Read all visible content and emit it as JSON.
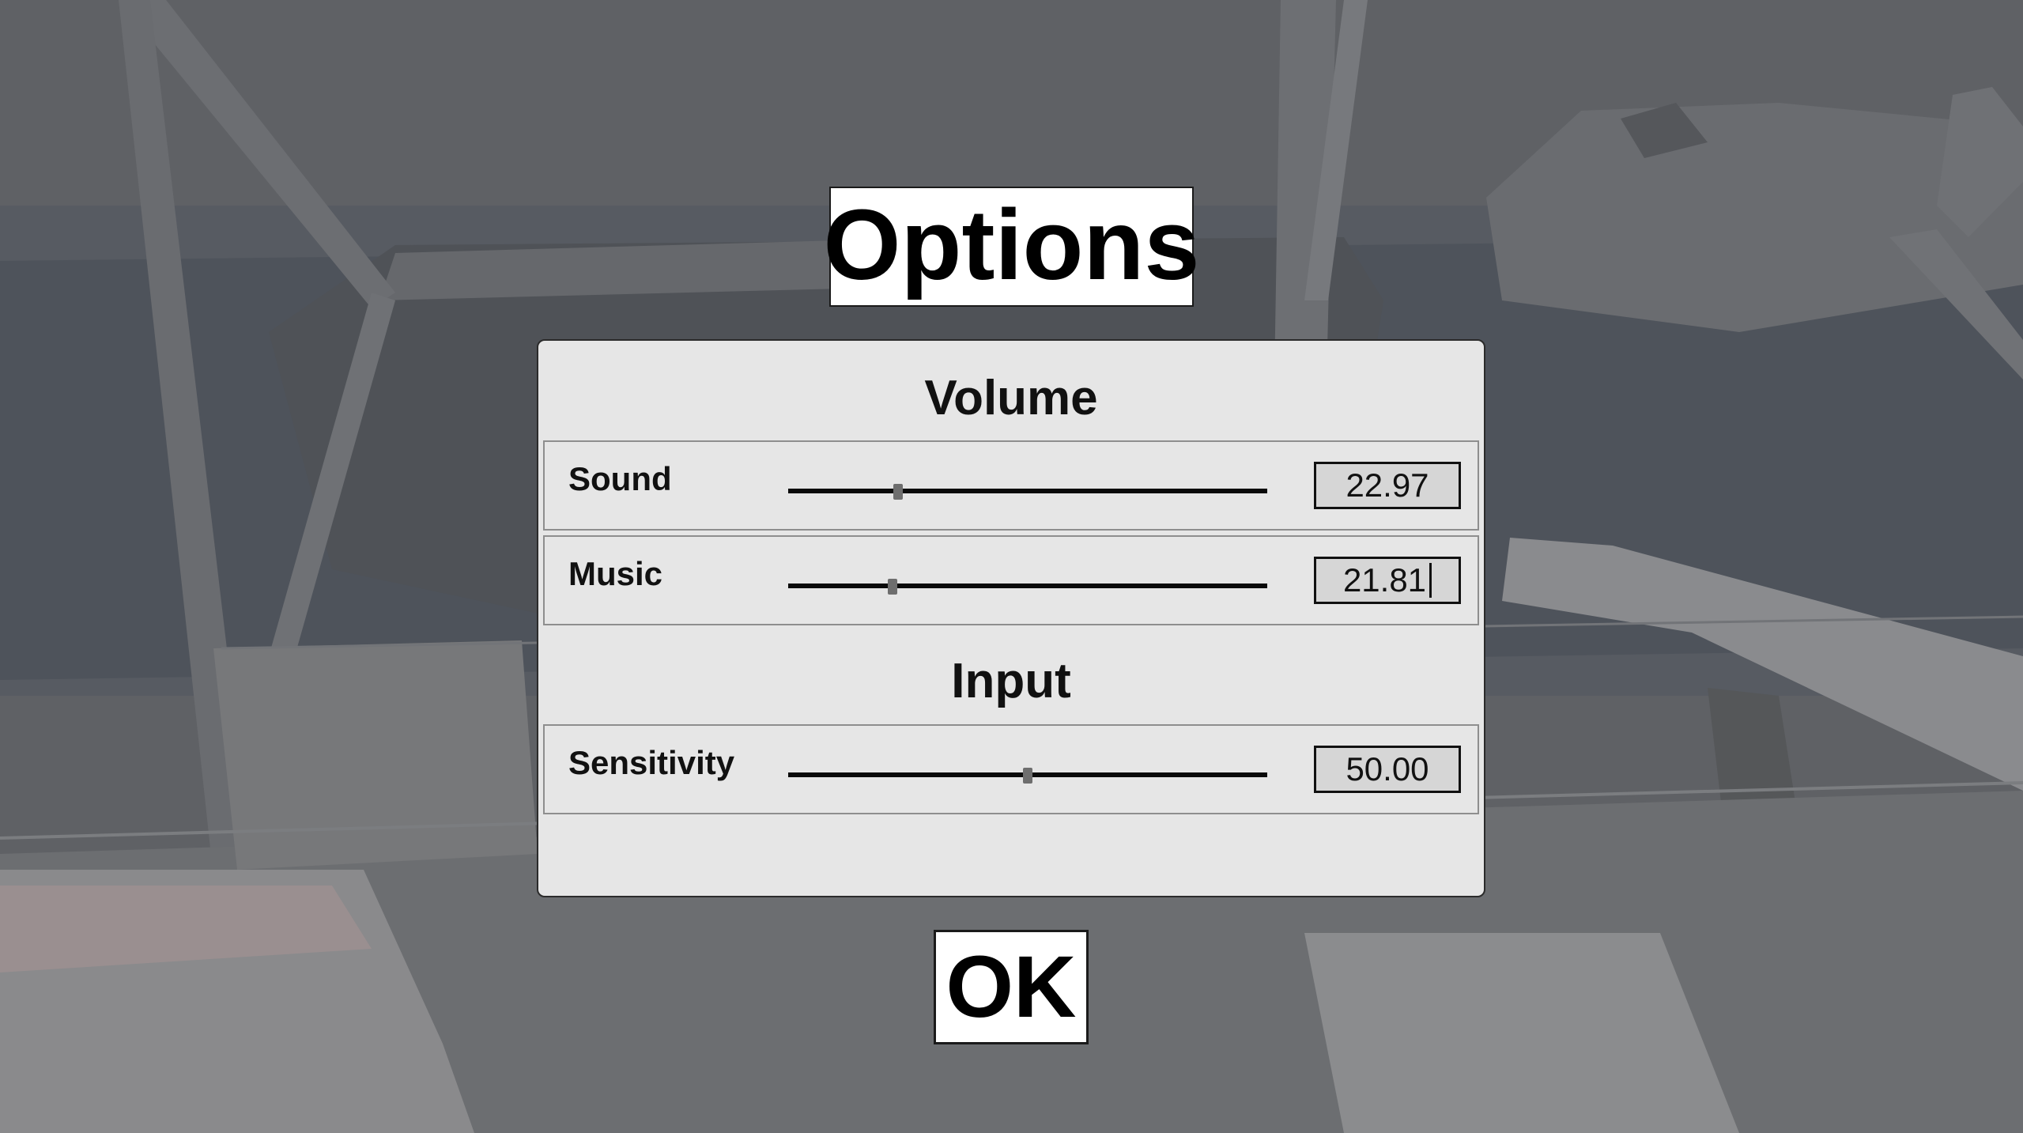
{
  "menu": {
    "title": "Options",
    "ok_label": "OK"
  },
  "volume": {
    "heading": "Volume",
    "sound": {
      "label": "Sound",
      "value": "22.97",
      "level": 0.2297
    },
    "music": {
      "label": "Music",
      "value": "21.81",
      "level": 0.2181,
      "focused": true
    }
  },
  "input": {
    "heading": "Input",
    "sensitivity": {
      "label": "Sensitivity",
      "value": "50.00",
      "level": 0.5
    }
  },
  "colors": {
    "panel_background": "#e6e6e6",
    "field_background": "#d6d6d6",
    "button_background": "#ffffff",
    "scene_tint": "#5c5e62"
  }
}
